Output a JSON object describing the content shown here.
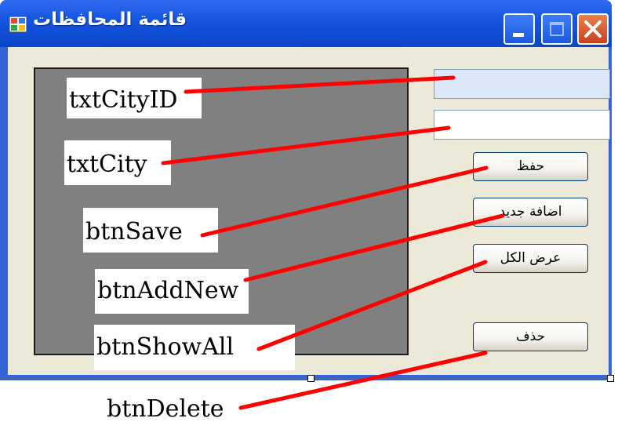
{
  "window": {
    "title": "قائمة المحافظات",
    "controls": {
      "minimize": "minimize-icon",
      "maximize": "maximize-icon",
      "close": "close-icon"
    }
  },
  "form": {
    "city_id_value": "",
    "city_value": "",
    "buttons": {
      "save": "حفظ",
      "add_new": "اضافة جديد",
      "show_all": "عرض الكل",
      "delete": "حذف"
    }
  },
  "annotations": {
    "txt_city_id": "txtCityID",
    "txt_city": "txtCity",
    "btn_save": "btnSave",
    "btn_add_new": "btnAddNew",
    "btn_show_all": "btnShowAll",
    "btn_delete": "btnDelete"
  },
  "colors": {
    "title_bar": "#0a45c8",
    "form_background": "#ece9d8",
    "panel": "#808080",
    "annotation_line": "#ff0000"
  }
}
